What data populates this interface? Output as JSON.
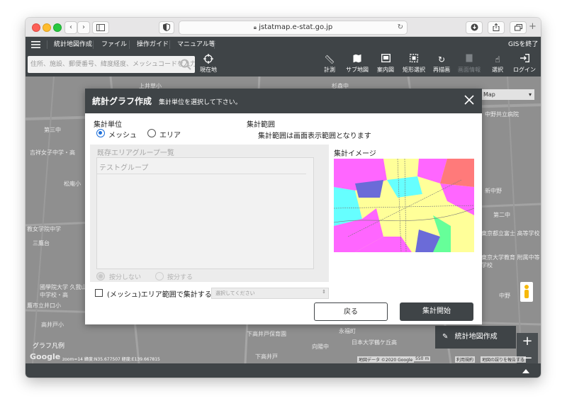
{
  "browser": {
    "url": "jstatmap.e-stat.go.jp",
    "nav_back": "‹",
    "nav_forward": "›",
    "new_tab": "+"
  },
  "appbar": {
    "menu_items": [
      "統計地図作成",
      "ファイル",
      "操作ガイド",
      "マニュアル等"
    ],
    "exit_label": "GISを終了"
  },
  "toolbar": {
    "search_placeholder": "住所、施設、郵便番号、緯度経度、メッシュコードを入力",
    "current_location": "現在地",
    "tools": [
      "計測",
      "サブ地図",
      "案内図",
      "矩形選択",
      "再描画",
      "画面情報",
      "選択",
      "ログイン"
    ]
  },
  "map": {
    "labels": [
      "第三中",
      "吉祥女子中学・高",
      "松庵小",
      "教女学院中学",
      "三鷹台",
      "國學院大学 久我山中学校・高",
      "鷹市立井口小",
      "高井戸小",
      "上井草小",
      "杉森中",
      "中野共立病院",
      "新中野",
      "第二中",
      "東京都立富士 高等学校",
      "東京大学教育 附属中等学校",
      "中野",
      "下高井戸保育園",
      "永福町",
      "向陽中",
      "日本大学鶴ケ丘高",
      "下高井戸"
    ],
    "map_type": "Map",
    "create_map_button": "統計地図作成",
    "zoom_in": "+",
    "zoom_out": "−",
    "legend": "グラフ凡例",
    "coords": "zoom=14  緯度:N35.677507  経度:E139.667815",
    "google": "Google",
    "attribution": "地図データ ©2020 Google",
    "scale": "550 m",
    "terms": "利用規約",
    "report": "地図の誤りを報告する"
  },
  "modal": {
    "title": "統計グラフ作成",
    "subtitle": "集計単位を選択して下さい。",
    "unit_label": "集計単位",
    "radio_mesh": "メッシュ",
    "radio_area": "エリア",
    "range_label": "集計範囲",
    "range_desc": "集計範囲は画面表示範囲となります",
    "group_list_label": "既存エリアグループ一覧",
    "group_item": "テストグループ",
    "split_no": "按分しない",
    "split_yes": "按分する",
    "checkbox_label": "(メッシュ)エリア範囲で集計する",
    "select_placeholder": "選択してください",
    "image_label": "集計イメージ",
    "back_button": "戻る",
    "start_button": "集計開始"
  },
  "colors": {
    "header": "#3f4447",
    "primary_button": "#3f4447",
    "radio_selected": "#1e6fd9"
  }
}
